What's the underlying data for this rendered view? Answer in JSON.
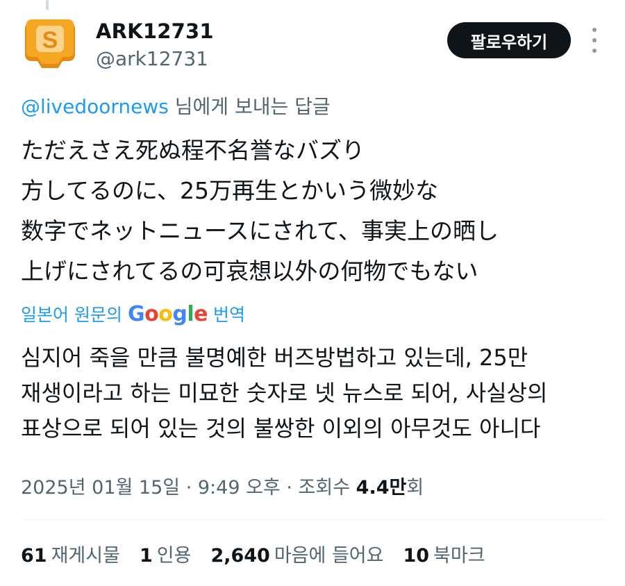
{
  "user": {
    "display_name": "ARK12731",
    "handle": "@ark12731"
  },
  "follow_label": "팔로우하기",
  "reply": {
    "mention": "@livedoornews",
    "suffix": " 님에게 보내는 답글"
  },
  "tweet_lines": [
    "ただえさえ死ぬ程不名誉なバズり",
    "方してるのに、25万再生とかいう微妙な",
    "数字でネットニュースにされて、事実上の晒し",
    "上げにされてるの可哀想以外の何物でもない"
  ],
  "translation": {
    "prefix": "일본어 원문의",
    "brand": "Google",
    "suffix": "번역",
    "lines": [
      "심지어 죽을 만큼 불명예한 버즈방법하고 있는데, 25만",
      "재생이라고 하는 미묘한 숫자로 넷 뉴스로 되어, 사실상의",
      "표상으로 되어 있는 것의 불쌍한 이외의 아무것도 아니다"
    ]
  },
  "meta": {
    "date": "2025년 01월 15일",
    "time": "9:49 오후",
    "views_label": "조회수",
    "views_count": "4.4만",
    "views_unit": "회"
  },
  "stats": [
    {
      "count": "61",
      "label": "재게시물"
    },
    {
      "count": "1",
      "label": "인용"
    },
    {
      "count": "2,640",
      "label": "마음에 들어요"
    },
    {
      "count": "10",
      "label": "북마크"
    }
  ],
  "colors": {
    "accent": "#1d9bf0",
    "avatar_bg": "#f5a623",
    "text_primary": "#0f1419",
    "text_secondary": "#536471"
  },
  "icons": {
    "avatar": "scratch-logo-icon",
    "more": "more-vertical-icon"
  }
}
